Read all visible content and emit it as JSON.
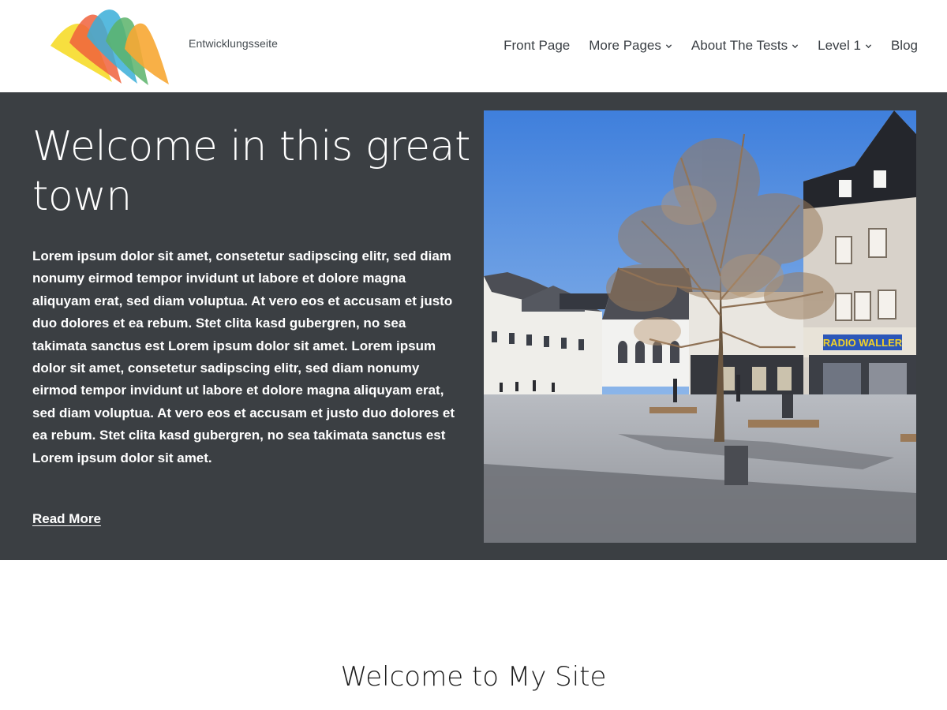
{
  "header": {
    "tagline": "Entwicklungsseite",
    "logo_icon": "colorful-waves-logo",
    "nav": [
      {
        "label": "Front Page",
        "has_submenu": false
      },
      {
        "label": "More Pages",
        "has_submenu": true
      },
      {
        "label": "About The Tests",
        "has_submenu": true
      },
      {
        "label": "Level 1",
        "has_submenu": true
      },
      {
        "label": "Blog",
        "has_submenu": false
      }
    ]
  },
  "hero": {
    "title": "Welcome in this great town",
    "body": "Lorem ipsum dolor sit amet, consetetur sadipscing elitr, sed diam nonumy eirmod tempor invidunt ut labore et dolore magna aliquyam erat, sed diam voluptua. At vero eos et accusam et justo duo dolores et ea rebum. Stet clita kasd gubergren, no sea takimata sanctus est Lorem ipsum dolor sit amet. Lorem ipsum dolor sit amet, consetetur sadipscing elitr, sed diam nonumy eirmod tempor invidunt ut labore et dolore magna aliquyam erat, sed diam voluptua. At vero eos et accusam et justo duo dolores et ea rebum. Stet clita kasd gubergren, no sea takimata sanctus est Lorem ipsum dolor sit amet.",
    "read_more": "Read More",
    "photo_sign": "RADIO WALLER"
  },
  "welcome": {
    "title": "Welcome to My Site"
  },
  "colors": {
    "hero_background": "#3b3f43",
    "text_light": "#ffffff",
    "nav_text": "#3a3f44"
  }
}
